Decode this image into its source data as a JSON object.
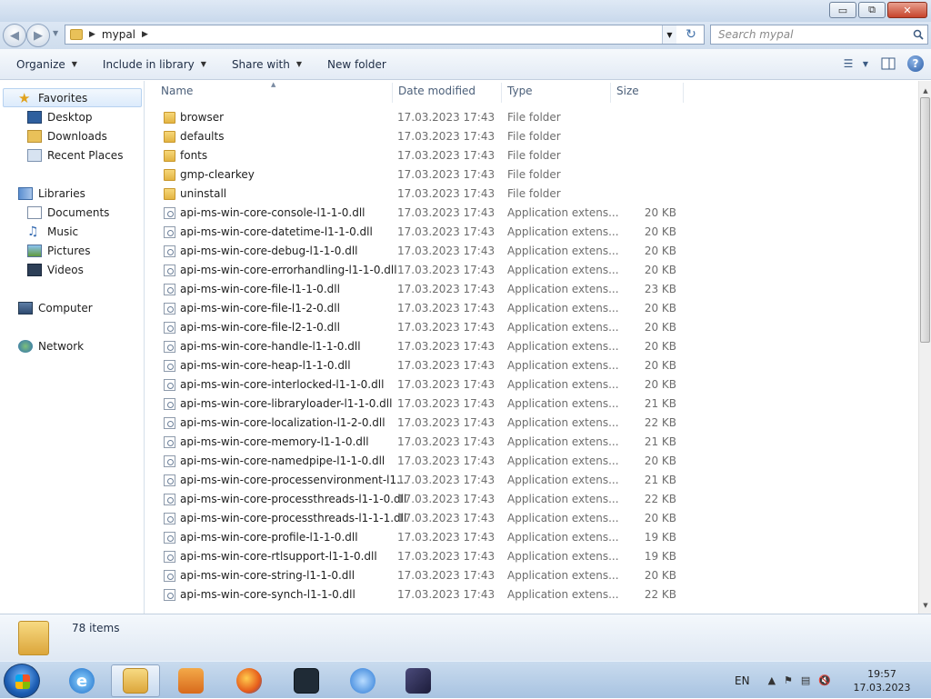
{
  "window": {
    "controls": {
      "minimize": "▭",
      "maximize": "⧉",
      "close": "✕"
    }
  },
  "address": {
    "path": [
      "mypal"
    ],
    "search_placeholder": "Search mypal"
  },
  "toolbar": {
    "organize": "Organize",
    "include_in_library": "Include in library",
    "share_with": "Share with",
    "new_folder": "New folder"
  },
  "navpane": {
    "favorites": "Favorites",
    "desktop": "Desktop",
    "downloads": "Downloads",
    "recent_places": "Recent Places",
    "libraries": "Libraries",
    "documents": "Documents",
    "music": "Music",
    "pictures": "Pictures",
    "videos": "Videos",
    "computer": "Computer",
    "network": "Network"
  },
  "columns": {
    "name": "Name",
    "date_modified": "Date modified",
    "type": "Type",
    "size": "Size"
  },
  "files": [
    {
      "name": "browser",
      "date": "17.03.2023 17:43",
      "type": "File folder",
      "size": "",
      "kind": "folder"
    },
    {
      "name": "defaults",
      "date": "17.03.2023 17:43",
      "type": "File folder",
      "size": "",
      "kind": "folder"
    },
    {
      "name": "fonts",
      "date": "17.03.2023 17:43",
      "type": "File folder",
      "size": "",
      "kind": "folder"
    },
    {
      "name": "gmp-clearkey",
      "date": "17.03.2023 17:43",
      "type": "File folder",
      "size": "",
      "kind": "folder"
    },
    {
      "name": "uninstall",
      "date": "17.03.2023 17:43",
      "type": "File folder",
      "size": "",
      "kind": "folder"
    },
    {
      "name": "api-ms-win-core-console-l1-1-0.dll",
      "date": "17.03.2023 17:43",
      "type": "Application extens...",
      "size": "20 KB",
      "kind": "dll"
    },
    {
      "name": "api-ms-win-core-datetime-l1-1-0.dll",
      "date": "17.03.2023 17:43",
      "type": "Application extens...",
      "size": "20 KB",
      "kind": "dll"
    },
    {
      "name": "api-ms-win-core-debug-l1-1-0.dll",
      "date": "17.03.2023 17:43",
      "type": "Application extens...",
      "size": "20 KB",
      "kind": "dll"
    },
    {
      "name": "api-ms-win-core-errorhandling-l1-1-0.dll",
      "date": "17.03.2023 17:43",
      "type": "Application extens...",
      "size": "20 KB",
      "kind": "dll"
    },
    {
      "name": "api-ms-win-core-file-l1-1-0.dll",
      "date": "17.03.2023 17:43",
      "type": "Application extens...",
      "size": "23 KB",
      "kind": "dll"
    },
    {
      "name": "api-ms-win-core-file-l1-2-0.dll",
      "date": "17.03.2023 17:43",
      "type": "Application extens...",
      "size": "20 KB",
      "kind": "dll"
    },
    {
      "name": "api-ms-win-core-file-l2-1-0.dll",
      "date": "17.03.2023 17:43",
      "type": "Application extens...",
      "size": "20 KB",
      "kind": "dll"
    },
    {
      "name": "api-ms-win-core-handle-l1-1-0.dll",
      "date": "17.03.2023 17:43",
      "type": "Application extens...",
      "size": "20 KB",
      "kind": "dll"
    },
    {
      "name": "api-ms-win-core-heap-l1-1-0.dll",
      "date": "17.03.2023 17:43",
      "type": "Application extens...",
      "size": "20 KB",
      "kind": "dll"
    },
    {
      "name": "api-ms-win-core-interlocked-l1-1-0.dll",
      "date": "17.03.2023 17:43",
      "type": "Application extens...",
      "size": "20 KB",
      "kind": "dll"
    },
    {
      "name": "api-ms-win-core-libraryloader-l1-1-0.dll",
      "date": "17.03.2023 17:43",
      "type": "Application extens...",
      "size": "21 KB",
      "kind": "dll"
    },
    {
      "name": "api-ms-win-core-localization-l1-2-0.dll",
      "date": "17.03.2023 17:43",
      "type": "Application extens...",
      "size": "22 KB",
      "kind": "dll"
    },
    {
      "name": "api-ms-win-core-memory-l1-1-0.dll",
      "date": "17.03.2023 17:43",
      "type": "Application extens...",
      "size": "21 KB",
      "kind": "dll"
    },
    {
      "name": "api-ms-win-core-namedpipe-l1-1-0.dll",
      "date": "17.03.2023 17:43",
      "type": "Application extens...",
      "size": "20 KB",
      "kind": "dll"
    },
    {
      "name": "api-ms-win-core-processenvironment-l1...",
      "date": "17.03.2023 17:43",
      "type": "Application extens...",
      "size": "21 KB",
      "kind": "dll"
    },
    {
      "name": "api-ms-win-core-processthreads-l1-1-0.dll",
      "date": "17.03.2023 17:43",
      "type": "Application extens...",
      "size": "22 KB",
      "kind": "dll"
    },
    {
      "name": "api-ms-win-core-processthreads-l1-1-1.dll",
      "date": "17.03.2023 17:43",
      "type": "Application extens...",
      "size": "20 KB",
      "kind": "dll"
    },
    {
      "name": "api-ms-win-core-profile-l1-1-0.dll",
      "date": "17.03.2023 17:43",
      "type": "Application extens...",
      "size": "19 KB",
      "kind": "dll"
    },
    {
      "name": "api-ms-win-core-rtlsupport-l1-1-0.dll",
      "date": "17.03.2023 17:43",
      "type": "Application extens...",
      "size": "19 KB",
      "kind": "dll"
    },
    {
      "name": "api-ms-win-core-string-l1-1-0.dll",
      "date": "17.03.2023 17:43",
      "type": "Application extens...",
      "size": "20 KB",
      "kind": "dll"
    },
    {
      "name": "api-ms-win-core-synch-l1-1-0.dll",
      "date": "17.03.2023 17:43",
      "type": "Application extens...",
      "size": "22 KB",
      "kind": "dll"
    }
  ],
  "details": {
    "items_count": "78 items"
  },
  "taskbar": {
    "apps": [
      "internet-explorer-icon",
      "windows-explorer-icon",
      "media-player-icon",
      "firefox-icon",
      "filmora-icon",
      "qbittorrent-icon",
      "movie-maker-icon"
    ],
    "language": "EN",
    "time": "19:57",
    "date": "17.03.2023"
  },
  "colors": {
    "accent": "#1c5db3",
    "folder": "#e3b442",
    "toolbar_bg": "#e3ebf5"
  }
}
